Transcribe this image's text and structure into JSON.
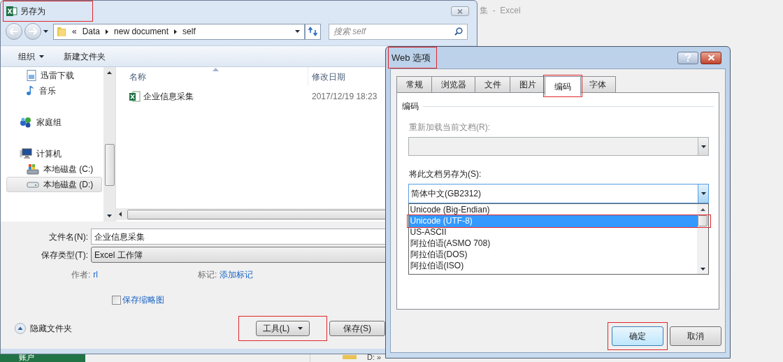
{
  "background_app": {
    "title_fragment": "集  -  Excel",
    "account_label": "账户",
    "path_fragment": "D: »"
  },
  "save_as": {
    "title": "另存为",
    "highlighted": true,
    "address": {
      "overflow": "«",
      "crumbs": [
        "Data",
        "new document",
        "self"
      ]
    },
    "search": {
      "placeholder": "搜索 self"
    },
    "toolbar": [
      {
        "label": "组织",
        "kind": "menu"
      },
      {
        "label": "新建文件夹",
        "kind": "plain"
      }
    ],
    "nav": [
      {
        "children": [
          {
            "label": "迅雷下载",
            "kind": "download",
            "selected": false
          },
          {
            "label": "音乐",
            "kind": "music",
            "selected": false
          }
        ]
      },
      {
        "label": "家庭组",
        "kind": "homegroup",
        "selected": false
      },
      {
        "label": "计算机",
        "kind": "computer",
        "selected": false,
        "children": [
          {
            "label": "本地磁盘 (C:)",
            "kind": "system-drive",
            "selected": false
          },
          {
            "label": "本地磁盘 (D:)",
            "kind": "drive",
            "selected": true
          }
        ]
      }
    ],
    "columns": [
      {
        "label": "名称",
        "sorted": true
      },
      {
        "label": "修改日期",
        "sorted": false
      }
    ],
    "files": [
      {
        "name": "企业信息采集",
        "modified": "2017/12/19 18:23"
      }
    ],
    "file_name": {
      "label": "文件名(N):",
      "value": "企业信息采集"
    },
    "save_type": {
      "label": "保存类型(T):",
      "value": "Excel 工作簿"
    },
    "meta": [
      {
        "label": "作者:",
        "value": "rl"
      },
      {
        "label": "标记:",
        "value": "添加标记"
      }
    ],
    "thumbnail": {
      "label": "保存缩略图",
      "checked": false
    },
    "hide_folders": "隐藏文件夹",
    "buttons": [
      {
        "label": "工具(L)",
        "kind": "menu",
        "highlighted": true
      },
      {
        "label": "保存(S)",
        "kind": "plain",
        "highlighted": false
      }
    ]
  },
  "web_options": {
    "title": "Web 选项",
    "highlighted": true,
    "tabs": [
      {
        "label": "常规",
        "selected": false,
        "highlighted": false
      },
      {
        "label": "浏览器",
        "selected": false,
        "highlighted": false
      },
      {
        "label": "文件",
        "selected": false,
        "highlighted": false
      },
      {
        "label": "图片",
        "selected": false,
        "highlighted": false
      },
      {
        "label": "编码",
        "selected": true,
        "highlighted": true
      },
      {
        "label": "字体",
        "selected": false,
        "highlighted": false
      }
    ],
    "group": "编码",
    "reload": {
      "label": "重新加载当前文档(R):",
      "disabled": true
    },
    "save_encoding": {
      "label": "将此文档另存为(S):",
      "value": "简体中文(GB2312)",
      "expanded": true
    },
    "options": [
      {
        "label": "Unicode (Big-Endian)",
        "selected": false,
        "highlighted": false
      },
      {
        "label": "Unicode (UTF-8)",
        "selected": true,
        "highlighted": true
      },
      {
        "label": "US-ASCII",
        "selected": false,
        "highlighted": false
      },
      {
        "label": "阿拉伯语(ASMO 708)",
        "selected": false,
        "highlighted": false
      },
      {
        "label": "阿拉伯语(DOS)",
        "selected": false,
        "highlighted": false
      },
      {
        "label": "阿拉伯语(ISO)",
        "selected": false,
        "highlighted": false
      }
    ],
    "buttons": [
      {
        "label": "确定",
        "default": true,
        "highlighted": true
      },
      {
        "label": "取消",
        "default": false,
        "highlighted": false
      }
    ]
  }
}
